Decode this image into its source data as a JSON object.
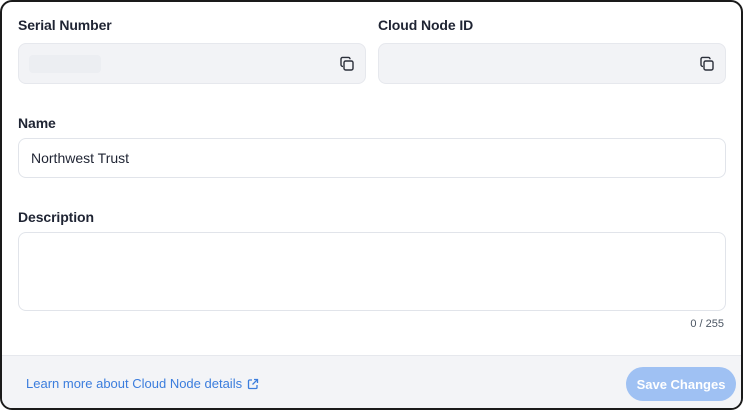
{
  "serial_number": {
    "label": "Serial Number",
    "value": "",
    "copy_icon": "copy-icon"
  },
  "cloud_node_id": {
    "label": "Cloud Node ID",
    "value": "",
    "copy_icon": "copy-icon"
  },
  "name": {
    "label": "Name",
    "value": "Northwest Trust"
  },
  "description": {
    "label": "Description",
    "value": "",
    "counter": "0 / 255"
  },
  "footer": {
    "learn_more_label": "Learn more about Cloud Node details",
    "external_icon": "external-link-icon",
    "save_label": "Save Changes",
    "link_color": "#3b7ddd",
    "save_button_color": "#9fc1f3"
  }
}
